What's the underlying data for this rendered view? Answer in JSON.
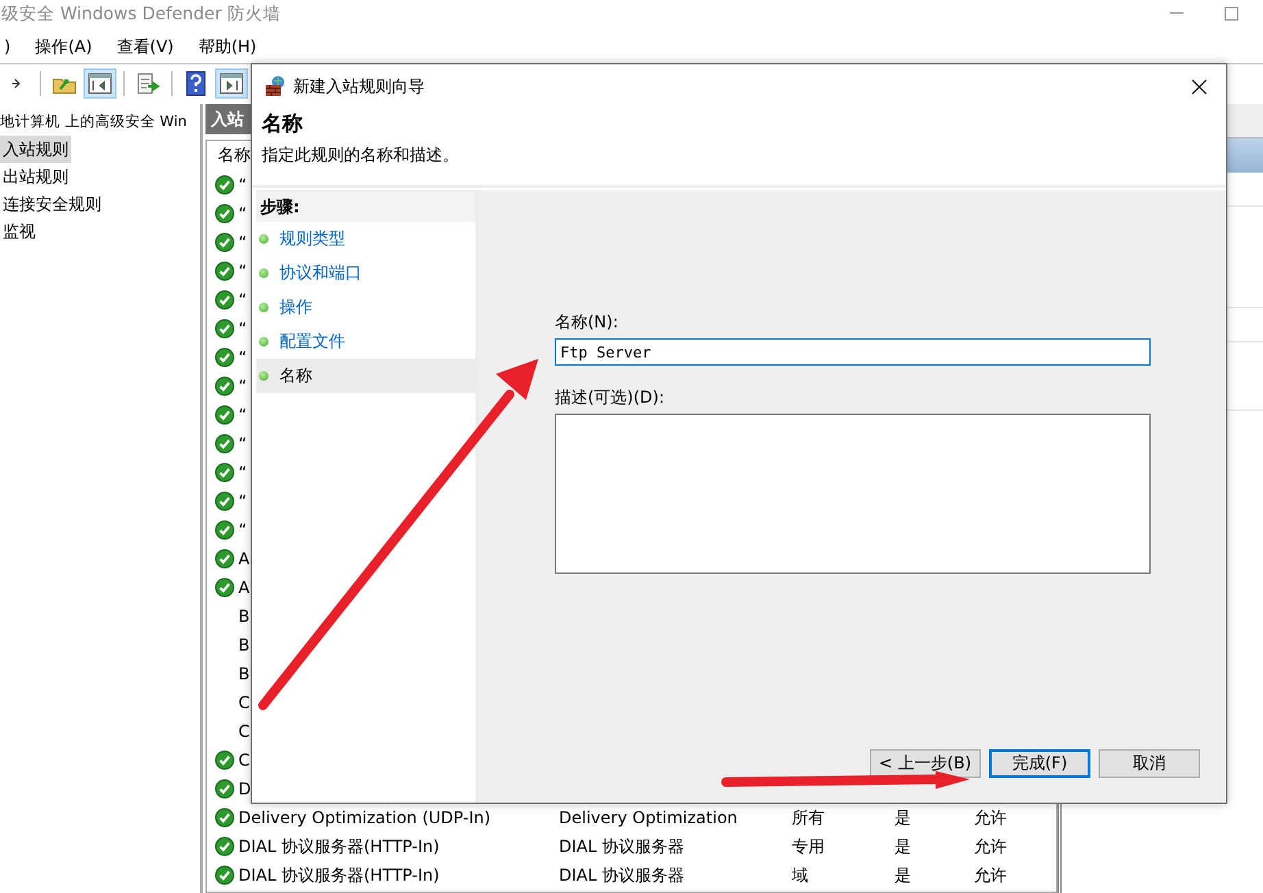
{
  "window": {
    "title": "级安全 Windows Defender 防火墙"
  },
  "menu": [
    ")",
    "操作(A)",
    "查看(V)",
    "帮助(H)"
  ],
  "toolbar": [
    {
      "kind": "forward",
      "pressed": false
    },
    {
      "kind": "folder_up",
      "pressed": false
    },
    {
      "kind": "tree_pane",
      "pressed": true
    },
    {
      "kind": "export",
      "pressed": false
    },
    {
      "kind": "help",
      "pressed": false
    },
    {
      "kind": "action_pane",
      "pressed": true
    }
  ],
  "tree": {
    "root": "地计算机 上的高级安全 Win",
    "items": [
      {
        "label": "入站规则",
        "selected": true
      },
      {
        "label": "出站规则",
        "selected": false
      },
      {
        "label": "连接安全规则",
        "selected": false
      },
      {
        "label": "监视",
        "selected": false
      }
    ]
  },
  "rules_pane": {
    "title": "入站",
    "columns": [
      "名称"
    ],
    "rows": [
      {
        "enabled": true,
        "cells": [
          "“"
        ]
      },
      {
        "enabled": true,
        "cells": [
          "“"
        ]
      },
      {
        "enabled": true,
        "cells": [
          "“"
        ]
      },
      {
        "enabled": true,
        "cells": [
          "“"
        ]
      },
      {
        "enabled": true,
        "cells": [
          "“"
        ]
      },
      {
        "enabled": true,
        "cells": [
          "“"
        ]
      },
      {
        "enabled": true,
        "cells": [
          "“"
        ]
      },
      {
        "enabled": true,
        "cells": [
          "“"
        ]
      },
      {
        "enabled": true,
        "cells": [
          "“"
        ]
      },
      {
        "enabled": true,
        "cells": [
          "“"
        ]
      },
      {
        "enabled": true,
        "cells": [
          "“"
        ]
      },
      {
        "enabled": true,
        "cells": [
          "“"
        ]
      },
      {
        "enabled": true,
        "cells": [
          "“"
        ]
      },
      {
        "enabled": true,
        "cells": [
          "A"
        ]
      },
      {
        "enabled": true,
        "cells": [
          "A"
        ]
      },
      {
        "enabled": false,
        "cells": [
          "B"
        ]
      },
      {
        "enabled": false,
        "cells": [
          "B"
        ]
      },
      {
        "enabled": false,
        "cells": [
          "B"
        ]
      },
      {
        "enabled": false,
        "cells": [
          "C"
        ]
      },
      {
        "enabled": false,
        "cells": [
          "C"
        ]
      },
      {
        "enabled": true,
        "cells": [
          "C"
        ]
      },
      {
        "enabled": true,
        "cells": [
          "D"
        ]
      },
      {
        "enabled": true,
        "cells": [
          "Delivery Optimization (UDP-In)",
          "Delivery Optimization",
          "所有",
          "是",
          "允许"
        ]
      },
      {
        "enabled": true,
        "cells": [
          "DIAL 协议服务器(HTTP-In)",
          "DIAL 协议服务器",
          "专用",
          "是",
          "允许"
        ]
      },
      {
        "enabled": true,
        "cells": [
          "DIAL 协议服务器(HTTP-In)",
          "DIAL 协议服务器",
          "域",
          "是",
          "允许"
        ]
      }
    ]
  },
  "dialog": {
    "title": "新建入站规则向导",
    "heading": "名称",
    "subtitle": "指定此规则的名称和描述。",
    "steps_title": "步骤:",
    "steps": [
      {
        "label": "规则类型",
        "selected": false
      },
      {
        "label": "协议和端口",
        "selected": false
      },
      {
        "label": "操作",
        "selected": false
      },
      {
        "label": "配置文件",
        "selected": false
      },
      {
        "label": "名称",
        "selected": true
      }
    ],
    "name_label": "名称(N):",
    "name_value": "Ftp Server",
    "description_label": "描述(可选)(D):",
    "buttons": [
      {
        "label": "< 上一步(B)",
        "default": false
      },
      {
        "label": "完成(F)",
        "default": true
      },
      {
        "label": "取消",
        "default": false
      }
    ]
  },
  "annotations": [
    {
      "kind": "arrow",
      "color": "#e8202a"
    },
    {
      "kind": "arrow",
      "color": "#e8202a"
    }
  ]
}
